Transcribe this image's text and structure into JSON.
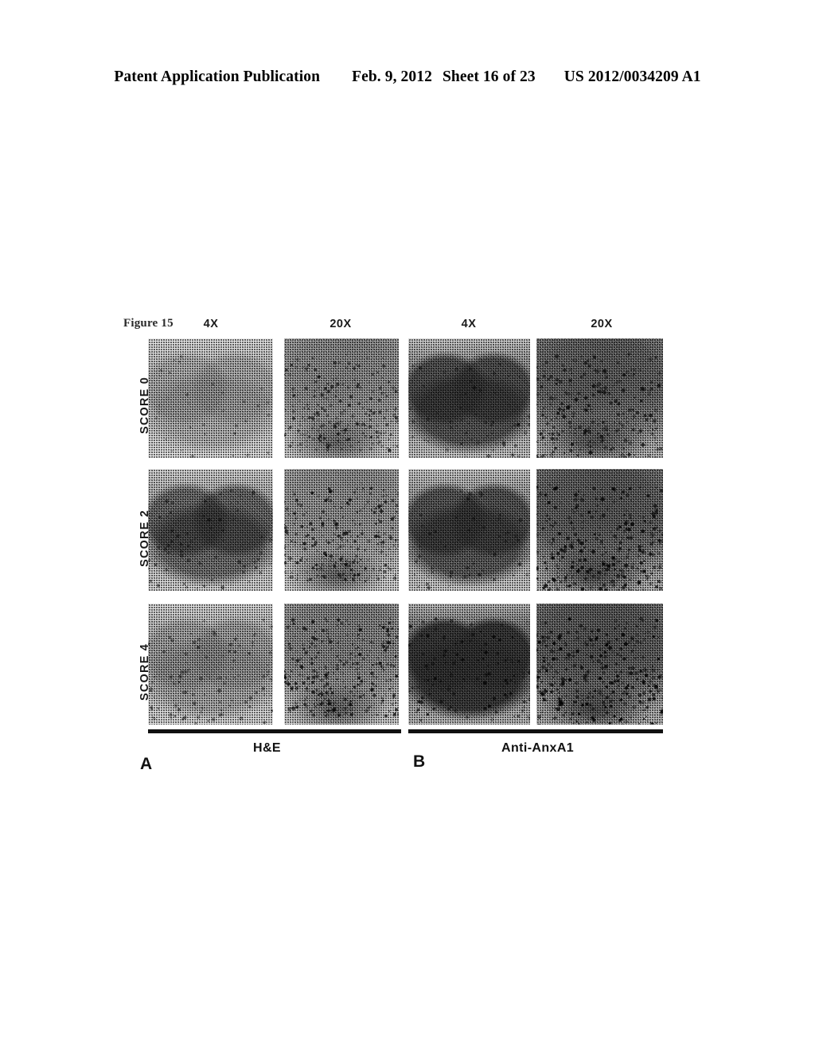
{
  "header": {
    "title": "Patent Application Publication",
    "date": "Feb. 9, 2012",
    "sheet": "Sheet 16 of 23",
    "publication_number": "US 2012/0034209 A1"
  },
  "figure": {
    "label": "Figure 15",
    "column_headers": [
      "4X",
      "20X",
      "4X",
      "20X"
    ],
    "row_labels": [
      "SCORE 0",
      "SCORE 2",
      "SCORE 4"
    ],
    "groups": [
      {
        "letter": "A",
        "caption": "H&E"
      },
      {
        "letter": "B",
        "caption": "Anti-AnxA1"
      }
    ],
    "panels": [
      {
        "row": "SCORE 0",
        "column": "4X",
        "group": "A",
        "stain": "H&E",
        "name": "panel-score0-4x-he"
      },
      {
        "row": "SCORE 0",
        "column": "20X",
        "group": "A",
        "stain": "H&E",
        "name": "panel-score0-20x-he"
      },
      {
        "row": "SCORE 0",
        "column": "4X",
        "group": "B",
        "stain": "Anti-AnxA1",
        "name": "panel-score0-4x-anxa1"
      },
      {
        "row": "SCORE 0",
        "column": "20X",
        "group": "B",
        "stain": "Anti-AnxA1",
        "name": "panel-score0-20x-anxa1"
      },
      {
        "row": "SCORE 2",
        "column": "4X",
        "group": "A",
        "stain": "H&E",
        "name": "panel-score2-4x-he"
      },
      {
        "row": "SCORE 2",
        "column": "20X",
        "group": "A",
        "stain": "H&E",
        "name": "panel-score2-20x-he"
      },
      {
        "row": "SCORE 2",
        "column": "4X",
        "group": "B",
        "stain": "Anti-AnxA1",
        "name": "panel-score2-4x-anxa1"
      },
      {
        "row": "SCORE 2",
        "column": "20X",
        "group": "B",
        "stain": "Anti-AnxA1",
        "name": "panel-score2-20x-anxa1"
      },
      {
        "row": "SCORE 4",
        "column": "4X",
        "group": "A",
        "stain": "H&E",
        "name": "panel-score4-4x-he"
      },
      {
        "row": "SCORE 4",
        "column": "20X",
        "group": "A",
        "stain": "H&E",
        "name": "panel-score4-20x-he"
      },
      {
        "row": "SCORE 4",
        "column": "4X",
        "group": "B",
        "stain": "Anti-AnxA1",
        "name": "panel-score4-4x-anxa1"
      },
      {
        "row": "SCORE 4",
        "column": "20X",
        "group": "B",
        "stain": "Anti-AnxA1",
        "name": "panel-score4-20x-anxa1"
      }
    ]
  },
  "colors": {
    "ink": "#000000",
    "page": "#ffffff",
    "panel_mid_gray": "#b9b9b9",
    "panel_dark_gray": "#6e6e6e",
    "panel_light_gray": "#e3e3e3"
  }
}
